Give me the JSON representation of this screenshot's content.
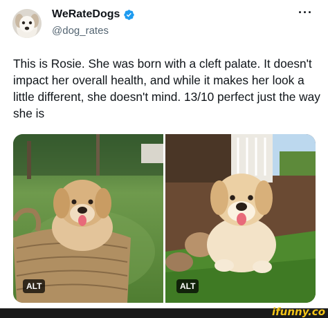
{
  "author": {
    "display_name": "WeRateDogs",
    "handle": "@dog_rates",
    "verified_color": "#1d9bf0"
  },
  "more_label": "···",
  "tweet": {
    "text": "This is Rosie. She was born with a cleft palate. It doesn't impact her overall health, and while it makes her look a little different, she doesn't mind. 13/10 perfect just the way she is"
  },
  "media": {
    "photos": [
      {
        "alt_label": "ALT"
      },
      {
        "alt_label": "ALT"
      }
    ]
  },
  "watermark": {
    "text": "ifunny.co"
  }
}
